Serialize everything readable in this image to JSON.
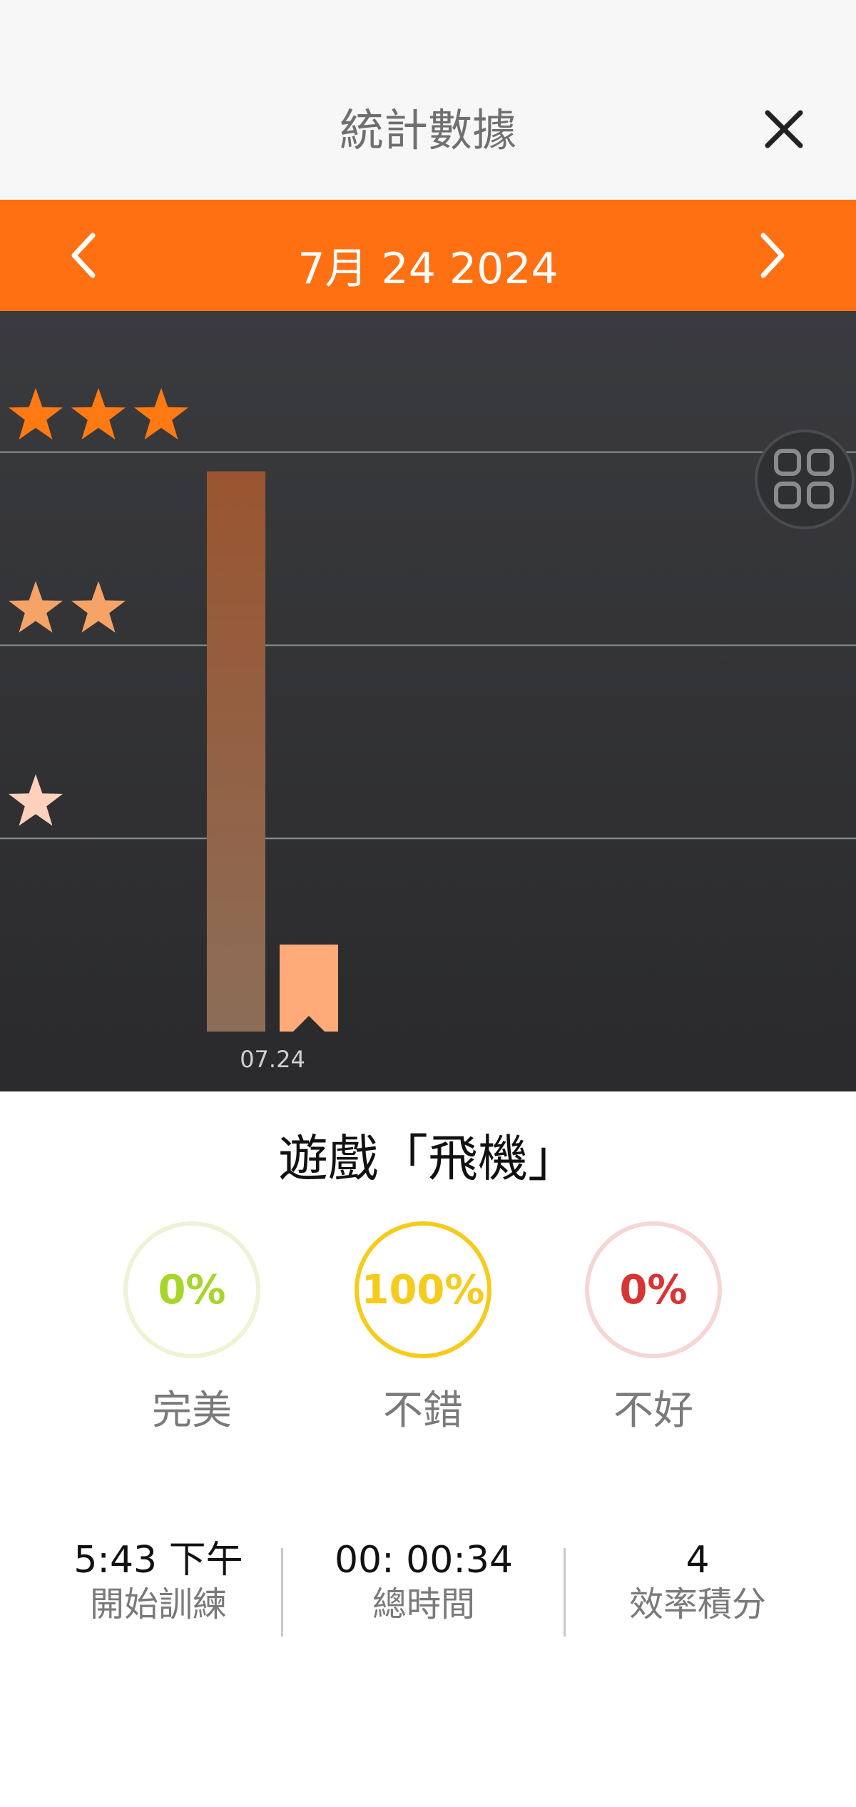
{
  "header": {
    "title": "統計數據"
  },
  "datebar": {
    "date": "7月 24 2024"
  },
  "chart_data": {
    "type": "bar",
    "y_levels": [
      "★",
      "★★",
      "★★★"
    ],
    "categories": [
      "07.24"
    ],
    "series": [
      {
        "values": [
          2.9
        ]
      },
      {
        "values": [
          0.45
        ]
      }
    ],
    "ylim": [
      0,
      3.25
    ],
    "colors": [
      "#8c5a3c",
      "#ffaa78"
    ]
  },
  "game": {
    "title": "遊戲「飛機」",
    "results": [
      {
        "percent": "0%",
        "label": "完美",
        "color": "#a8d52a",
        "ring": "#eef3d6"
      },
      {
        "percent": "100%",
        "label": "不錯",
        "color": "#f5cb1c",
        "ring": "#f5cb1c"
      },
      {
        "percent": "0%",
        "label": "不好",
        "color": "#d93434",
        "ring": "#f6d5d5"
      }
    ]
  },
  "stats": [
    {
      "value": "5:43 下午",
      "label": "開始訓練"
    },
    {
      "value": "00: 00:34",
      "label": "總時間"
    },
    {
      "value": "4",
      "label": "效率積分"
    }
  ],
  "colors": {
    "accent": "#ff7012"
  }
}
